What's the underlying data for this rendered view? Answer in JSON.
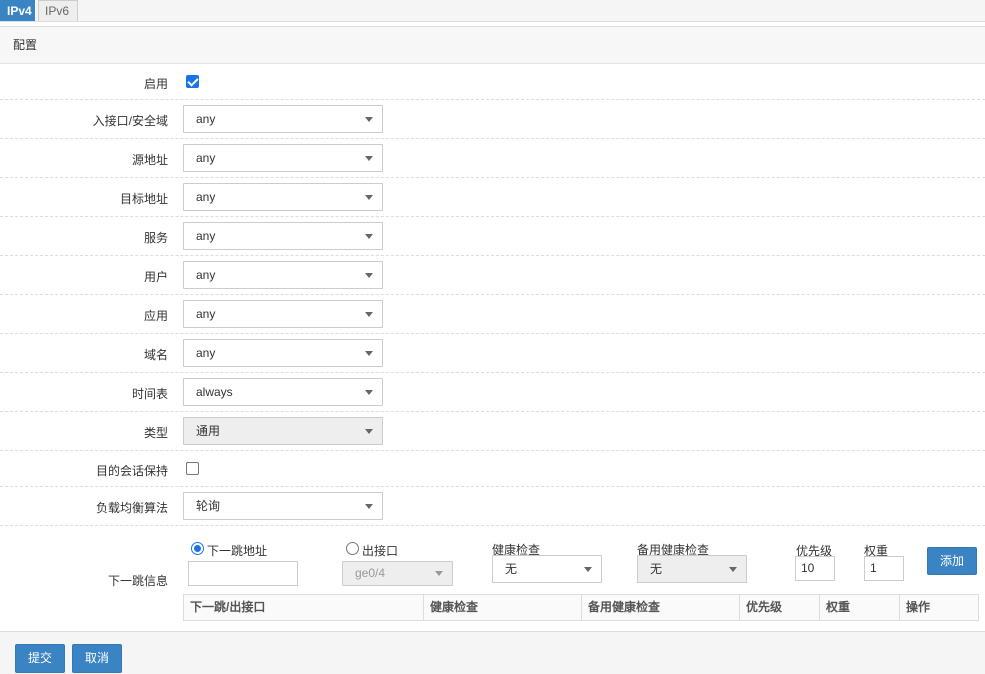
{
  "tabs": [
    {
      "label": "IPv4",
      "active": true
    },
    {
      "label": "IPv6",
      "active": false
    }
  ],
  "panel": {
    "title": "配置"
  },
  "form": {
    "enable": {
      "label": "启用",
      "checked": true
    },
    "in_interface": {
      "label": "入接口/安全域",
      "value": "any"
    },
    "src_addr": {
      "label": "源地址",
      "value": "any"
    },
    "dst_addr": {
      "label": "目标地址",
      "value": "any"
    },
    "service": {
      "label": "服务",
      "value": "any"
    },
    "user": {
      "label": "用户",
      "value": "any"
    },
    "application": {
      "label": "应用",
      "value": "any"
    },
    "domain": {
      "label": "域名",
      "value": "any"
    },
    "schedule": {
      "label": "时间表",
      "value": "always"
    },
    "type": {
      "label": "类型",
      "value": "通用",
      "disabled": true
    },
    "session_keep": {
      "label": "目的会话保持",
      "checked": false
    },
    "lb_algorithm": {
      "label": "负载均衡算法",
      "value": "轮询"
    }
  },
  "nexthop": {
    "label": "下一跳信息",
    "radio_addr": {
      "label": "下一跳地址",
      "checked": true
    },
    "addr_value": "",
    "radio_iface": {
      "label": "出接口",
      "checked": false
    },
    "iface_value": "ge0/4",
    "health_label": "健康检查",
    "health_value": "无",
    "backup_health_label": "备用健康检查",
    "backup_health_value": "无",
    "priority_label": "优先级",
    "priority_value": "10",
    "weight_label": "权重",
    "weight_value": "1",
    "add_button": "添加",
    "columns": [
      "下一跳/出接口",
      "健康检查",
      "备用健康检查",
      "优先级",
      "权重",
      "操作"
    ]
  },
  "footer": {
    "submit": "提交",
    "cancel": "取消"
  },
  "colors": {
    "accent": "#3a84c4",
    "checkbox": "#1a73e8"
  }
}
